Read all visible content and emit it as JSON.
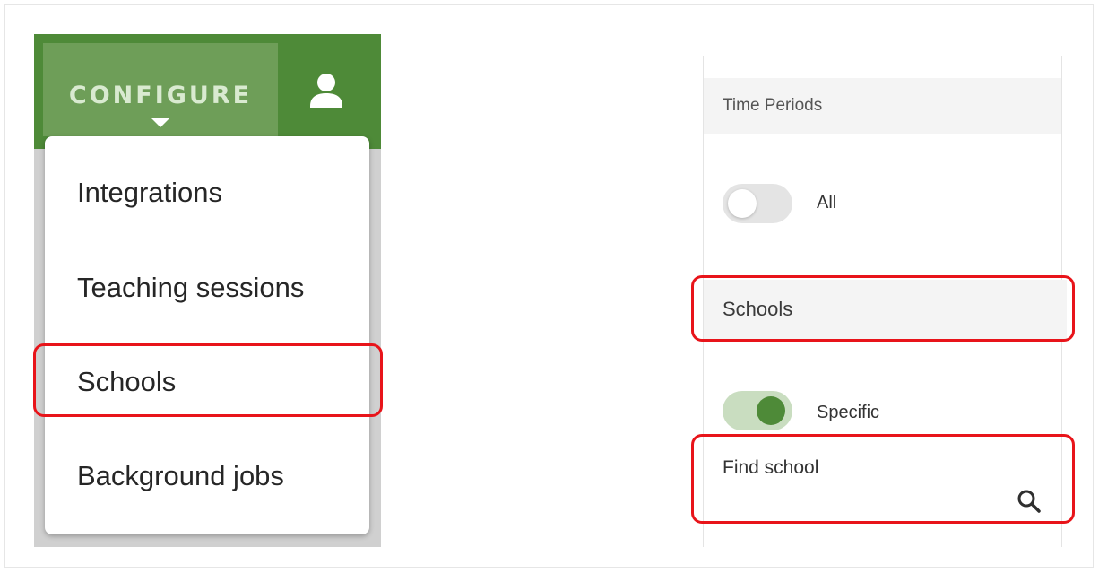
{
  "header": {
    "configure_label": "CONFIGURE"
  },
  "dropdown": {
    "items": [
      {
        "label": "Integrations"
      },
      {
        "label": "Teaching sessions"
      },
      {
        "label": "Schools"
      },
      {
        "label": "Background jobs"
      }
    ]
  },
  "filters": {
    "time_periods": {
      "header": "Time Periods",
      "toggle_label": "All",
      "toggle_on": false
    },
    "schools": {
      "header": "Schools",
      "toggle_label": "Specific",
      "toggle_on": true,
      "search_label": "Find school"
    }
  },
  "icons": {
    "user": "user-icon",
    "caret": "caret-down-icon",
    "search": "search-icon"
  },
  "colors": {
    "header_green": "#4e8a38",
    "tab_green": "#6e9e58",
    "highlight_red": "#e8141a",
    "toggle_on_knob": "#4e8a38",
    "section_header_bg": "#f4f4f4"
  }
}
